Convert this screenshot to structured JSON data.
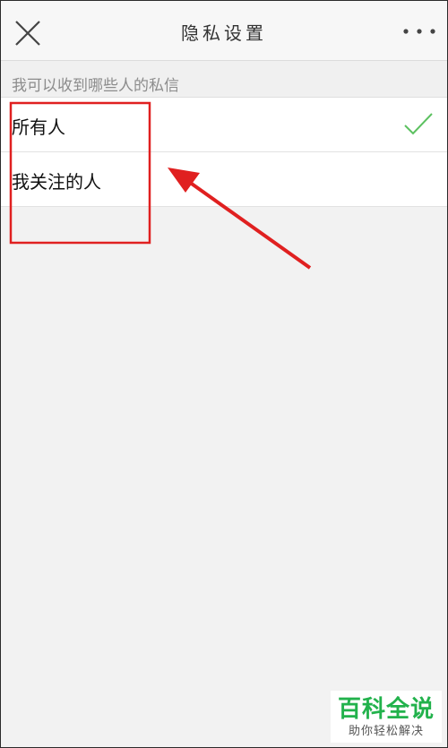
{
  "nav": {
    "title": "隐私设置"
  },
  "section": {
    "header": "我可以收到哪些人的私信"
  },
  "options": [
    {
      "label": "所有人",
      "selected": true
    },
    {
      "label": "我关注的人",
      "selected": false
    }
  ],
  "watermark": {
    "title": "百科全说",
    "subtitle": "助你轻松解决"
  },
  "colors": {
    "check": "#5cc160",
    "annotation": "#e02020",
    "watermark": "#22b24c"
  }
}
